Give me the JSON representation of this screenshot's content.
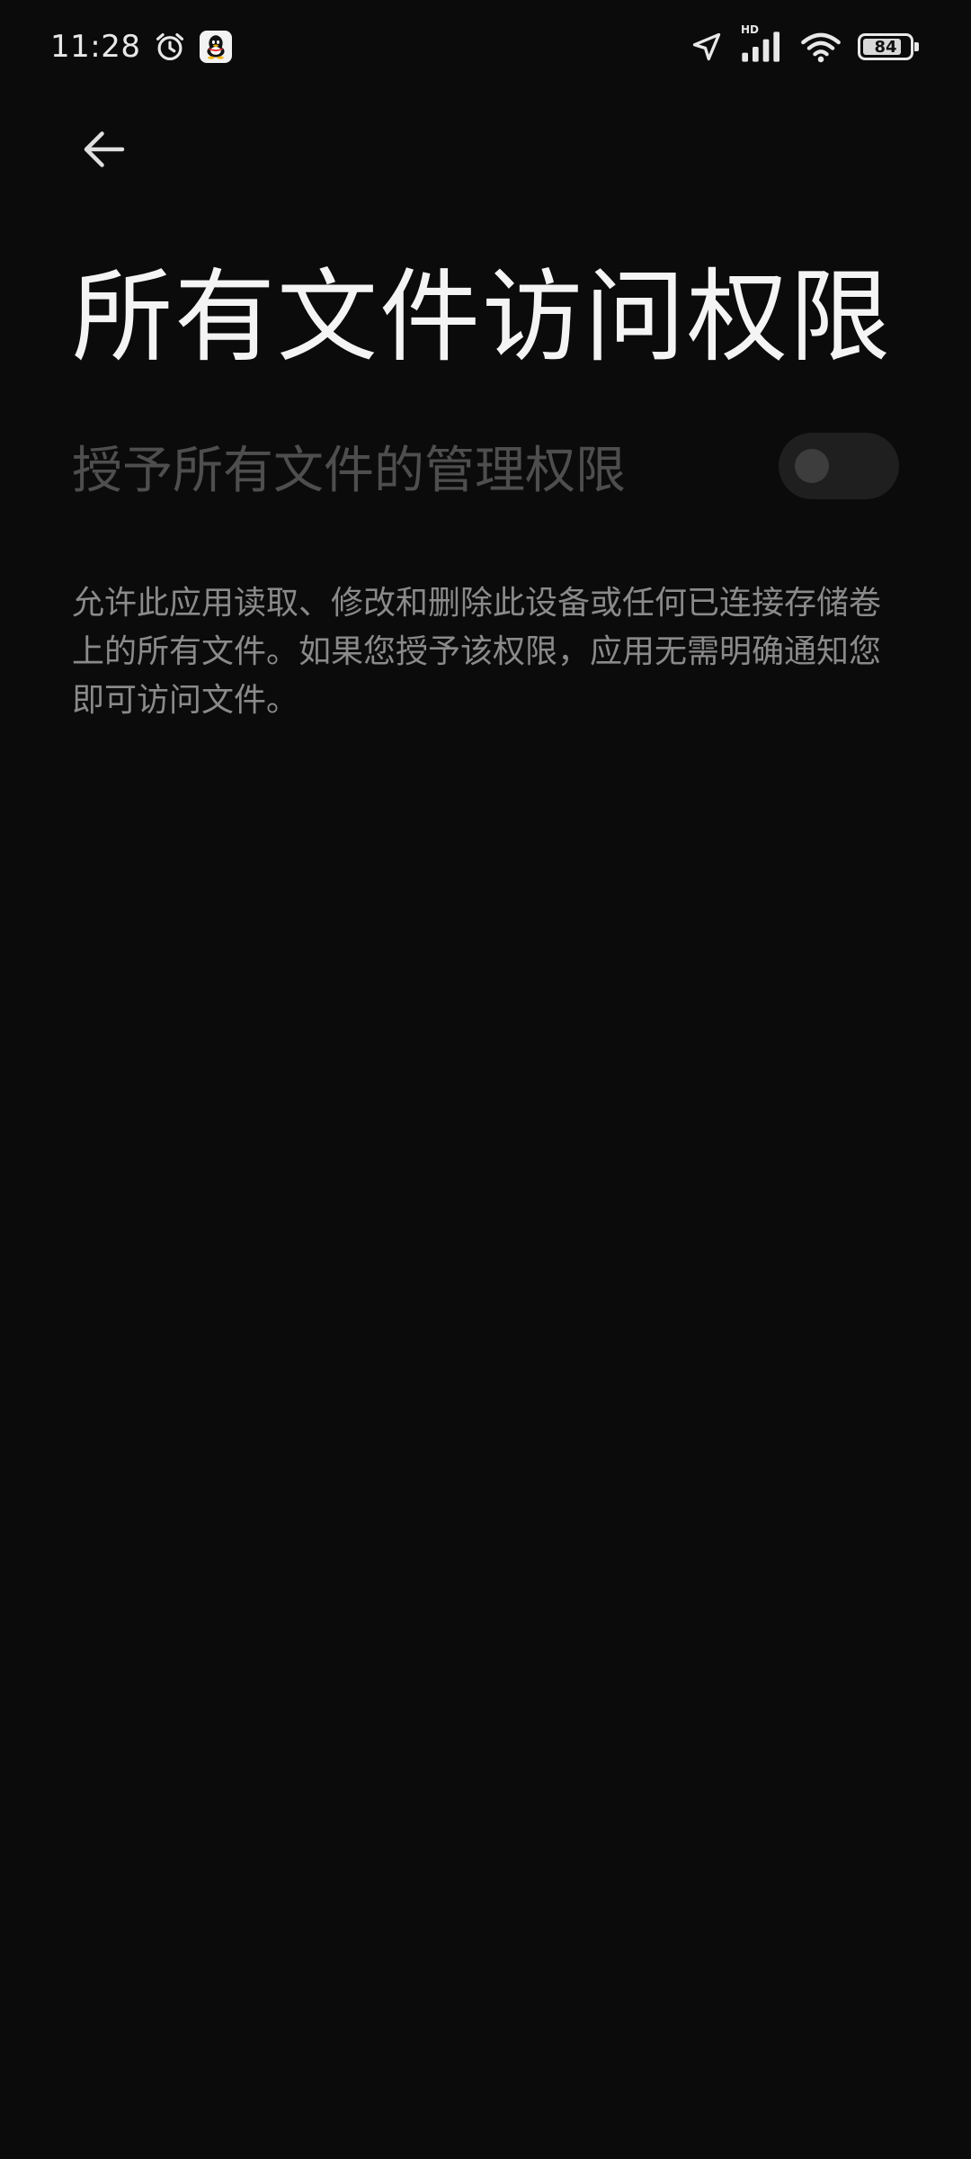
{
  "status_bar": {
    "time": "11:28",
    "battery_level": 84,
    "battery_label": "84",
    "network_label": "HD",
    "icons": [
      "alarm-icon",
      "qq-app-icon",
      "location-arrow-icon",
      "cell-signal-icon",
      "wifi-icon",
      "battery-icon"
    ]
  },
  "header": {
    "back_icon": "arrow-left-icon",
    "title": "所有文件访问权限"
  },
  "permission": {
    "toggle_label": "授予所有文件的管理权限",
    "toggle_state": "off",
    "description": "允许此应用读取、修改和删除此设备或任何已连接存储卷上的所有文件。如果您授予该权限，应用无需明确通知您即可访问文件。"
  }
}
